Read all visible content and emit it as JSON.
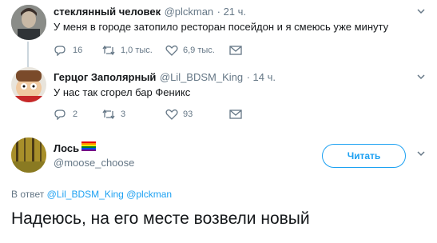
{
  "tweets": [
    {
      "name": "стеклянный человек",
      "handle": "@plckman",
      "time": "· 21 ч.",
      "text": "У меня в городе затопило ресторан посейдон и я смеюсь уже минуту",
      "replies": "16",
      "retweets": "1,0 тыс.",
      "likes": "6,9 тыс."
    },
    {
      "name": "Герцог Заполярный",
      "handle": "@Lil_BDSM_King",
      "time": "· 14 ч.",
      "text": "У нас так сгорел бар Феникс",
      "replies": "2",
      "retweets": "3",
      "likes": "93"
    }
  ],
  "main": {
    "name": "Лось",
    "handle": "@moose_choose",
    "follow_label": "Читать",
    "reply_prefix": "В ответ",
    "reply_to_1": "@Lil_BDSM_King",
    "reply_to_2": "@plckman",
    "text": "Надеюсь, на его месте возвели новый"
  },
  "icons": {
    "reply": "reply-icon",
    "retweet": "retweet-icon",
    "like": "heart-icon",
    "dm": "envelope-icon",
    "menu": "chevron-down-icon",
    "flag": "rainbow-flag-icon"
  },
  "colors": {
    "accent": "#1da1f2",
    "muted": "#657786",
    "line": "#ccd6dd"
  }
}
